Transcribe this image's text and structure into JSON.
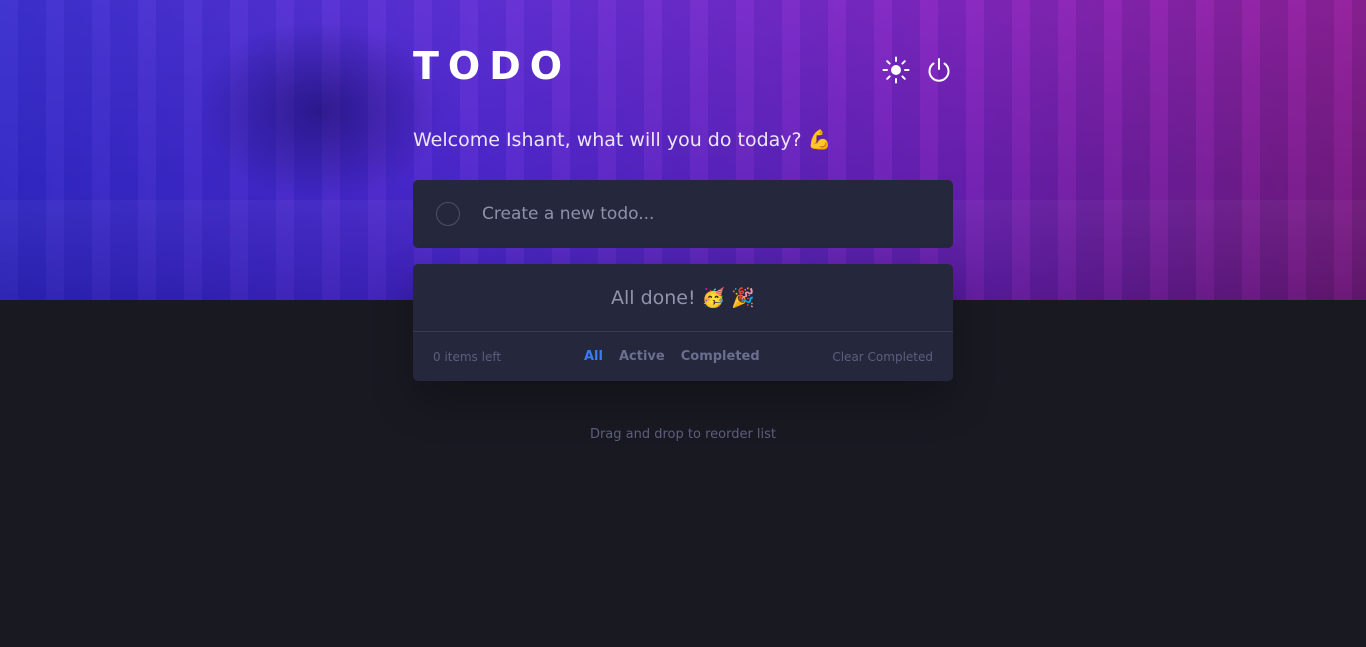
{
  "header": {
    "title": "TODO",
    "theme_toggle_icon": "sun-icon",
    "logout_icon": "power-icon"
  },
  "welcome": {
    "text": "Welcome Ishant, what will you do today? 💪"
  },
  "new_todo": {
    "placeholder": "Create a new todo...",
    "value": ""
  },
  "list": {
    "empty_message": "All done! 🥳 🎉",
    "items_left": "0 items left",
    "filters": [
      {
        "label": "All",
        "active": true
      },
      {
        "label": "Active",
        "active": false
      },
      {
        "label": "Completed",
        "active": false
      }
    ],
    "clear_label": "Clear Completed"
  },
  "hint": "Drag and drop to reorder list",
  "colors": {
    "accent": "#3a7bfd",
    "background": "#191922",
    "card": "#25273c"
  }
}
